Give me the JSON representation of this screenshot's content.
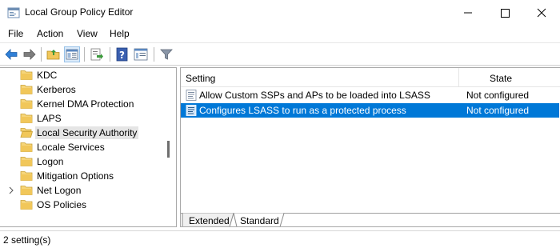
{
  "window": {
    "title": "Local Group Policy Editor"
  },
  "menu": {
    "items": [
      "File",
      "Action",
      "View",
      "Help"
    ]
  },
  "toolbar": {
    "icons": [
      "back-arrow-icon",
      "forward-arrow-icon",
      "up-folder-icon",
      "show-hide-tree-icon",
      "export-list-icon",
      "help-icon",
      "properties-icon",
      "filter-icon"
    ]
  },
  "tree": {
    "items": [
      {
        "label": "KDC",
        "expandable": false
      },
      {
        "label": "Kerberos",
        "expandable": false
      },
      {
        "label": "Kernel DMA Protection",
        "expandable": false
      },
      {
        "label": "LAPS",
        "expandable": false
      },
      {
        "label": "Local Security Authority",
        "expandable": false,
        "selected": true
      },
      {
        "label": "Locale Services",
        "expandable": false
      },
      {
        "label": "Logon",
        "expandable": false
      },
      {
        "label": "Mitigation Options",
        "expandable": false
      },
      {
        "label": "Net Logon",
        "expandable": true
      },
      {
        "label": "OS Policies",
        "expandable": false
      }
    ]
  },
  "list": {
    "headers": {
      "setting": "Setting",
      "state": "State"
    },
    "rows": [
      {
        "setting": "Allow Custom SSPs and APs to be loaded into LSASS",
        "state": "Not configured",
        "selected": false
      },
      {
        "setting": "Configures LSASS to run as a protected process",
        "state": "Not configured",
        "selected": true
      }
    ]
  },
  "tabs": [
    "Extended",
    "Standard"
  ],
  "status": {
    "text": "2 setting(s)"
  },
  "colors": {
    "selection": "#0078d7",
    "folder": "#f1c75a"
  }
}
